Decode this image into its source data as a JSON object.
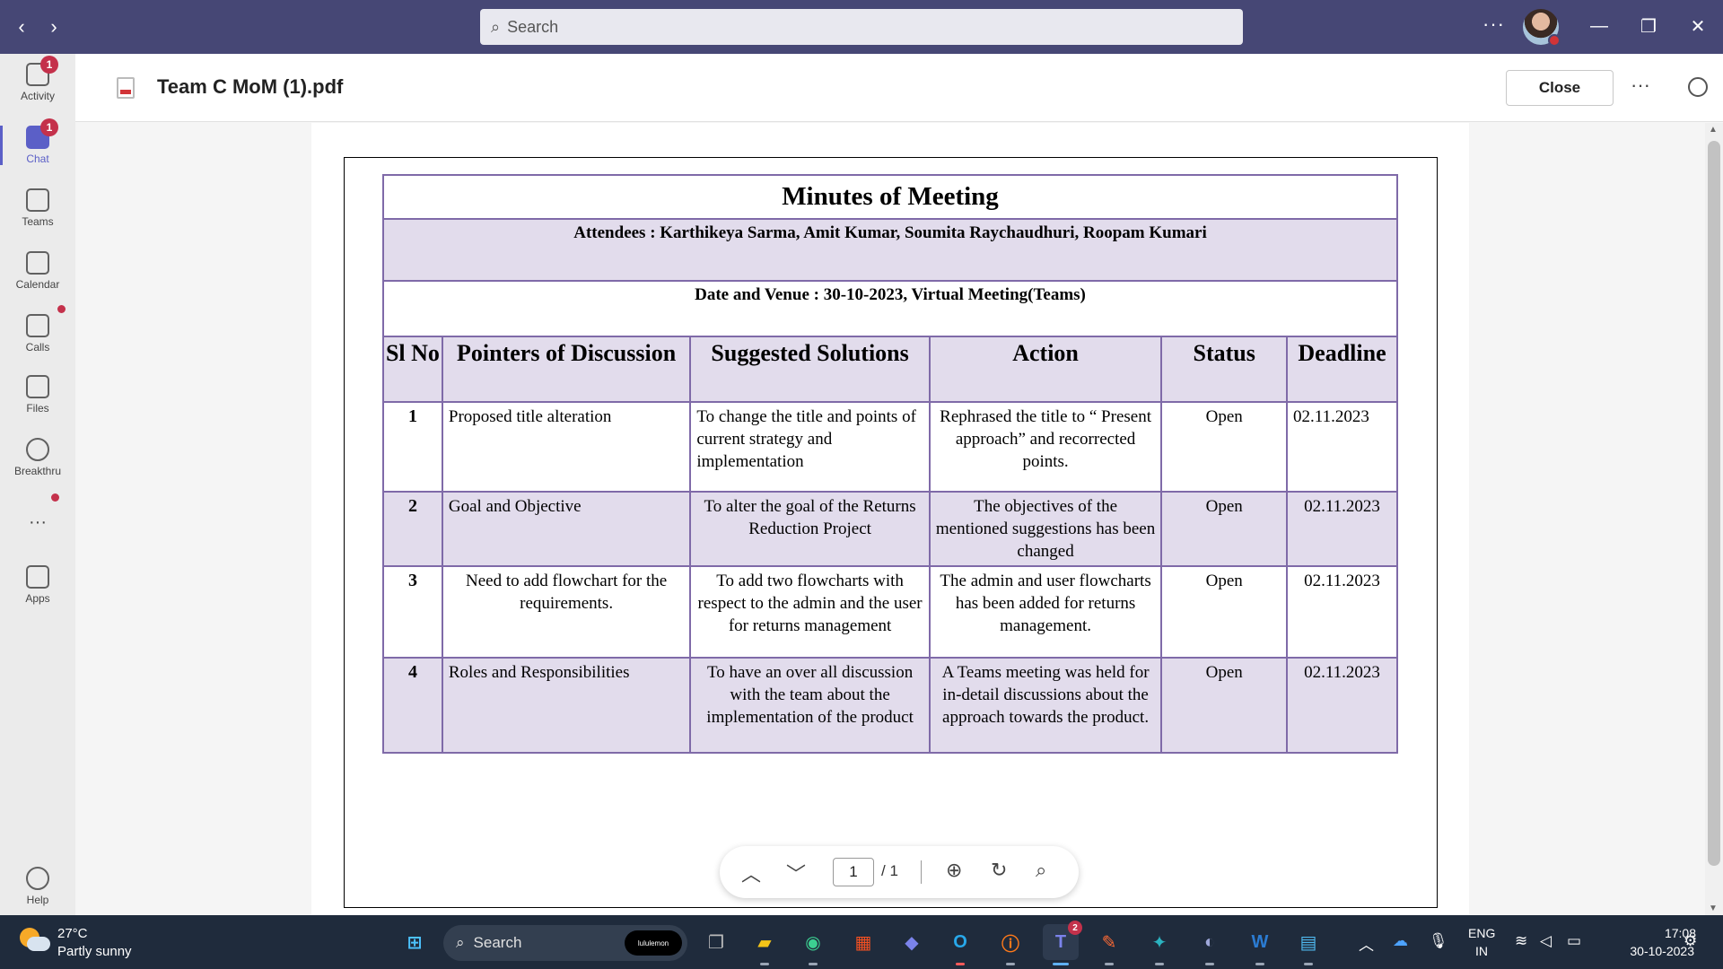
{
  "titlebar": {
    "search_placeholder": "Search",
    "more": "···",
    "minimize": "—",
    "maximize": "❐",
    "close": "✕"
  },
  "rail": {
    "items": [
      {
        "label": "Activity",
        "badge": "1"
      },
      {
        "label": "Chat",
        "badge": "1"
      },
      {
        "label": "Teams"
      },
      {
        "label": "Calendar"
      },
      {
        "label": "Calls"
      },
      {
        "label": "Files"
      },
      {
        "label": "Breakthru"
      },
      {
        "label": "···"
      },
      {
        "label": "Apps"
      },
      {
        "label": "Help"
      }
    ]
  },
  "header": {
    "title": "Team C MoM (1).pdf",
    "close_label": "Close",
    "more": "···"
  },
  "document": {
    "title": "Minutes of Meeting",
    "attendees": "Attendees : Karthikeya Sarma, Amit Kumar, Soumita Raychaudhuri, Roopam Kumari",
    "date_venue": "Date and Venue : 30-10-2023, Virtual Meeting(Teams)",
    "columns": [
      "Sl No",
      "Pointers of Discussion",
      "Suggested Solutions",
      "Action",
      "Status",
      "Deadline"
    ],
    "rows": [
      {
        "sl": "1",
        "pointer": "Proposed title alteration",
        "solution": "To change the title and points of current strategy and implementation",
        "action": "Rephrased the title to “ Present approach” and recorrected points.",
        "status": "Open",
        "deadline": "02.11.2023"
      },
      {
        "sl": "2",
        "pointer": "Goal and Objective",
        "solution": "To alter the goal of the Returns Reduction Project",
        "action": "The objectives of the mentioned suggestions has been changed",
        "status": "Open",
        "deadline": "02.11.2023"
      },
      {
        "sl": "3",
        "pointer": "Need to add flowchart for the requirements.",
        "solution": "To add two flowcharts with respect to the admin and the user for returns management",
        "action": "The admin and user flowcharts has been added for returns management.",
        "status": "Open",
        "deadline": "02.11.2023"
      },
      {
        "sl": "4",
        "pointer": "Roles and Responsibilities",
        "solution": "To have an over all discussion with the team about the implementation of the product",
        "action": "A Teams meeting was held for in-detail discussions about the approach towards the product.",
        "status": "Open",
        "deadline": "02.11.2023"
      }
    ]
  },
  "pdf_toolbar": {
    "page_current": "1",
    "page_total": "/ 1"
  },
  "taskbar": {
    "temperature": "27°C",
    "condition": "Partly sunny",
    "search_label": "Search",
    "search_pill": "lululemon",
    "teams_badge": "2",
    "lang_line1": "ENG",
    "lang_line2": "IN",
    "time": "17:08",
    "date": "30-10-2023"
  },
  "colors": {
    "titlebar": "#464775",
    "accent": "#5b5fc7",
    "table_border": "#7f6aa8",
    "table_shade": "#e2dcec",
    "taskbar": "#1f2b3c"
  }
}
